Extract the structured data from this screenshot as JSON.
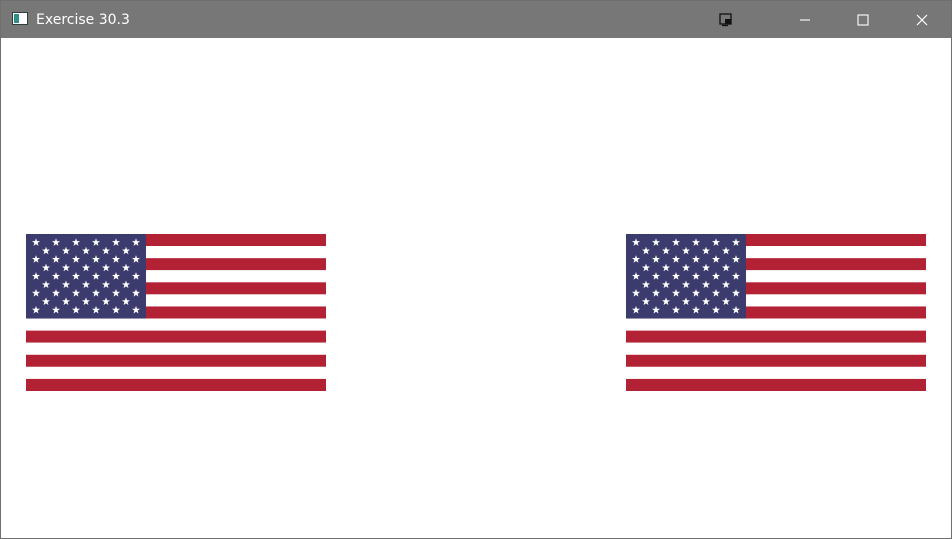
{
  "window": {
    "title": "Exercise 30.3",
    "controls": [
      {
        "name": "picture-in-picture",
        "icon": "pip-icon"
      },
      {
        "name": "minimize",
        "icon": "minimize-icon"
      },
      {
        "name": "maximize",
        "icon": "maximize-icon"
      },
      {
        "name": "close",
        "icon": "close-icon"
      }
    ]
  },
  "colors": {
    "titlebar": "#777777",
    "background": "#ffffff",
    "flag_red": "#b22234",
    "flag_white": "#ffffff",
    "flag_blue": "#3c3b6e"
  },
  "flags": [
    {
      "name": "left-us-flag",
      "stripes": 13,
      "stars": 50
    },
    {
      "name": "right-us-flag",
      "stripes": 13,
      "stars": 50
    }
  ]
}
